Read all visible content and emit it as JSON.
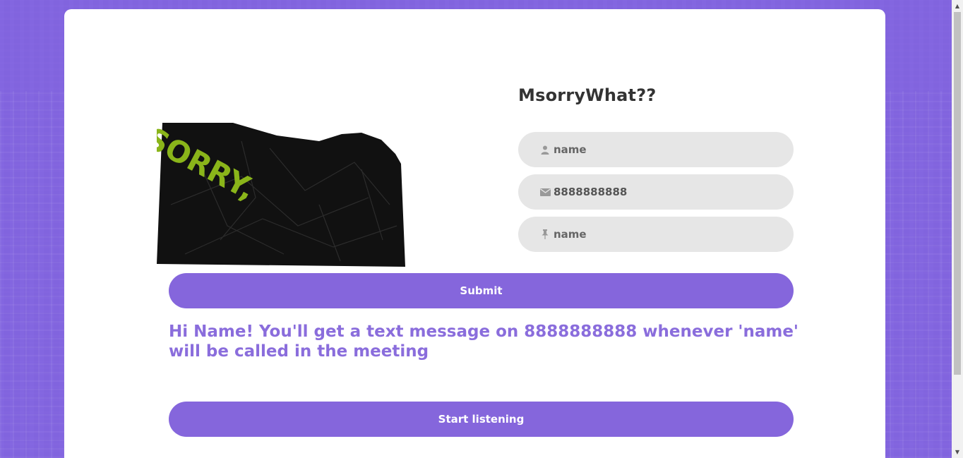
{
  "app": {
    "title": "MsorryWhat??"
  },
  "illustration": {
    "text": "I SORRY,",
    "colors": {
      "paper": "#111111",
      "text": "#8ab51a"
    }
  },
  "form": {
    "name_field": {
      "icon": "user-icon",
      "value": "",
      "placeholder": "name"
    },
    "phone_field": {
      "icon": "envelope-icon",
      "value": "8888888888",
      "placeholder": ""
    },
    "keyword_field": {
      "icon": "pin-icon",
      "value": "",
      "placeholder": "name"
    },
    "submit_label": "Submit"
  },
  "message": "Hi Name! You'll get a text message on 8888888888 whenever 'name' will be called in the meeting",
  "listen_button": {
    "label": "Start listening"
  },
  "colors": {
    "accent": "#8566dc",
    "message": "#8a6ddc",
    "field_bg": "#e6e6e6"
  }
}
